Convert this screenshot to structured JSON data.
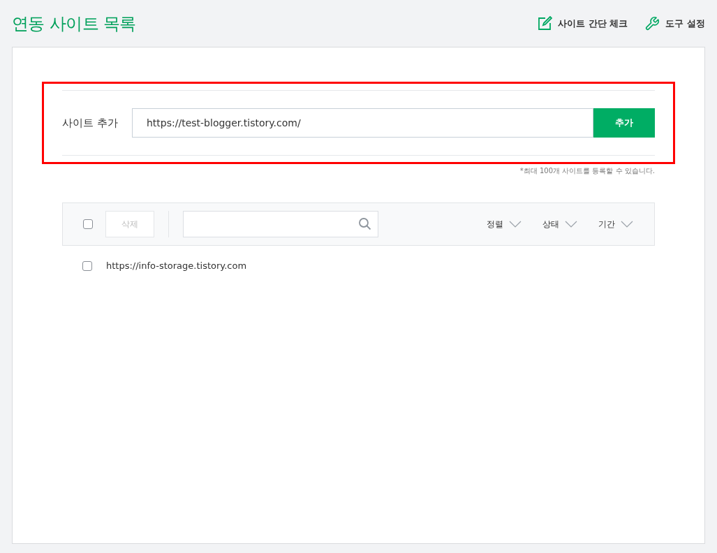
{
  "header": {
    "title": "연동 사이트 목록",
    "actions": [
      {
        "kind": "check",
        "label": "사이트 간단 체크"
      },
      {
        "kind": "settings",
        "label": "도구 설정"
      }
    ]
  },
  "add_site": {
    "label": "사이트 추가",
    "value": "https://test-blogger.tistory.com/",
    "button": "추가",
    "note": "*최대 100개 사이트를 등록할 수 있습니다."
  },
  "toolbar": {
    "select_all_checked": false,
    "delete_button": {
      "label": "삭제",
      "disabled": true
    },
    "filters": [
      "정렬",
      "상태",
      "기간"
    ]
  },
  "sites": [
    {
      "url": "https://info-storage.tistory.com",
      "checked": false
    }
  ]
}
